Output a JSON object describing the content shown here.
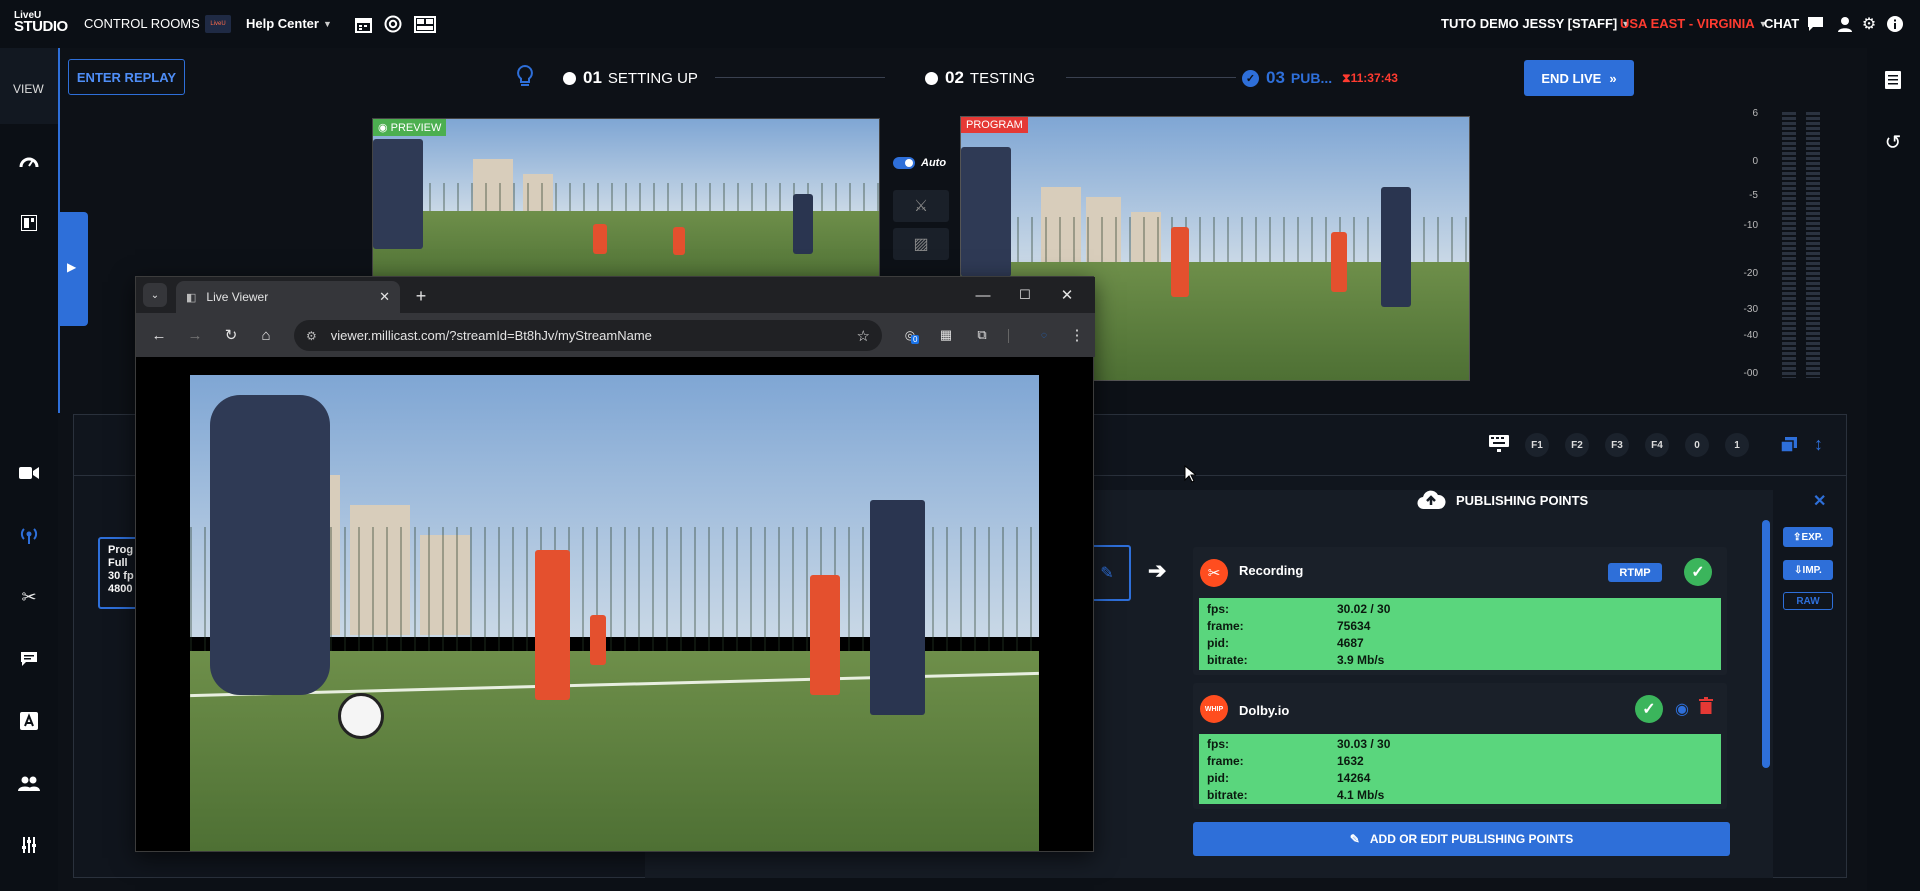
{
  "topbar": {
    "logo_line1": "LiveU",
    "logo_line2": "STUDIO",
    "control_rooms": "CONTROL ROOMS",
    "help_badge": "LiveU",
    "help_center": "Help Center",
    "user": "TUTO DEMO JESSY [STAFF]",
    "region": "USA EAST - VIRGINIA",
    "chat": "CHAT",
    "region_color": "#ff3b30"
  },
  "leftnav": {
    "view_label": "VIEW"
  },
  "toolbar": {
    "enter_replay": "ENTER REPLAY",
    "end_live": "END LIVE"
  },
  "steps": [
    {
      "num": "01",
      "label": "SETTING UP"
    },
    {
      "num": "02",
      "label": "TESTING"
    },
    {
      "num": "03",
      "label": "PUB...",
      "timer": "11:37:43"
    }
  ],
  "preview": {
    "label": "PREVIEW"
  },
  "program": {
    "label": "PROGRAM"
  },
  "transition": {
    "auto_label": "Auto"
  },
  "audio_meter": {
    "scale": [
      "6",
      "0",
      "-5",
      "-10",
      "-20",
      "-30",
      "-40",
      "-00"
    ]
  },
  "fkeys": [
    "F1",
    "F2",
    "F3",
    "F4",
    "0",
    "1"
  ],
  "source_card": {
    "lines": [
      "Prog",
      "Full",
      "30 fp",
      "4800"
    ]
  },
  "publishing": {
    "title": "PUBLISHING POINTS",
    "export": "EXP.",
    "import": "IMP.",
    "raw": "RAW",
    "add_edit": "ADD OR EDIT PUBLISHING POINTS",
    "points": [
      {
        "name": "Recording",
        "badge": "RTMP",
        "stats": [
          {
            "k": "fps:",
            "v": "30.02 / 30"
          },
          {
            "k": "frame:",
            "v": "75634"
          },
          {
            "k": "pid:",
            "v": "4687"
          },
          {
            "k": "bitrate:",
            "v": "3.9 Mb/s"
          }
        ]
      },
      {
        "name": "Dolby.io",
        "icon_text": "WHIP",
        "stats": [
          {
            "k": "fps:",
            "v": "30.03 / 30"
          },
          {
            "k": "frame:",
            "v": "1632"
          },
          {
            "k": "pid:",
            "v": "14264"
          },
          {
            "k": "bitrate:",
            "v": "4.1 Mb/s"
          }
        ]
      }
    ]
  },
  "browser": {
    "tab_title": "Live Viewer",
    "url": "viewer.millicast.com/?streamId=Bt8hJv/myStreamName",
    "ext_badge": "0"
  }
}
